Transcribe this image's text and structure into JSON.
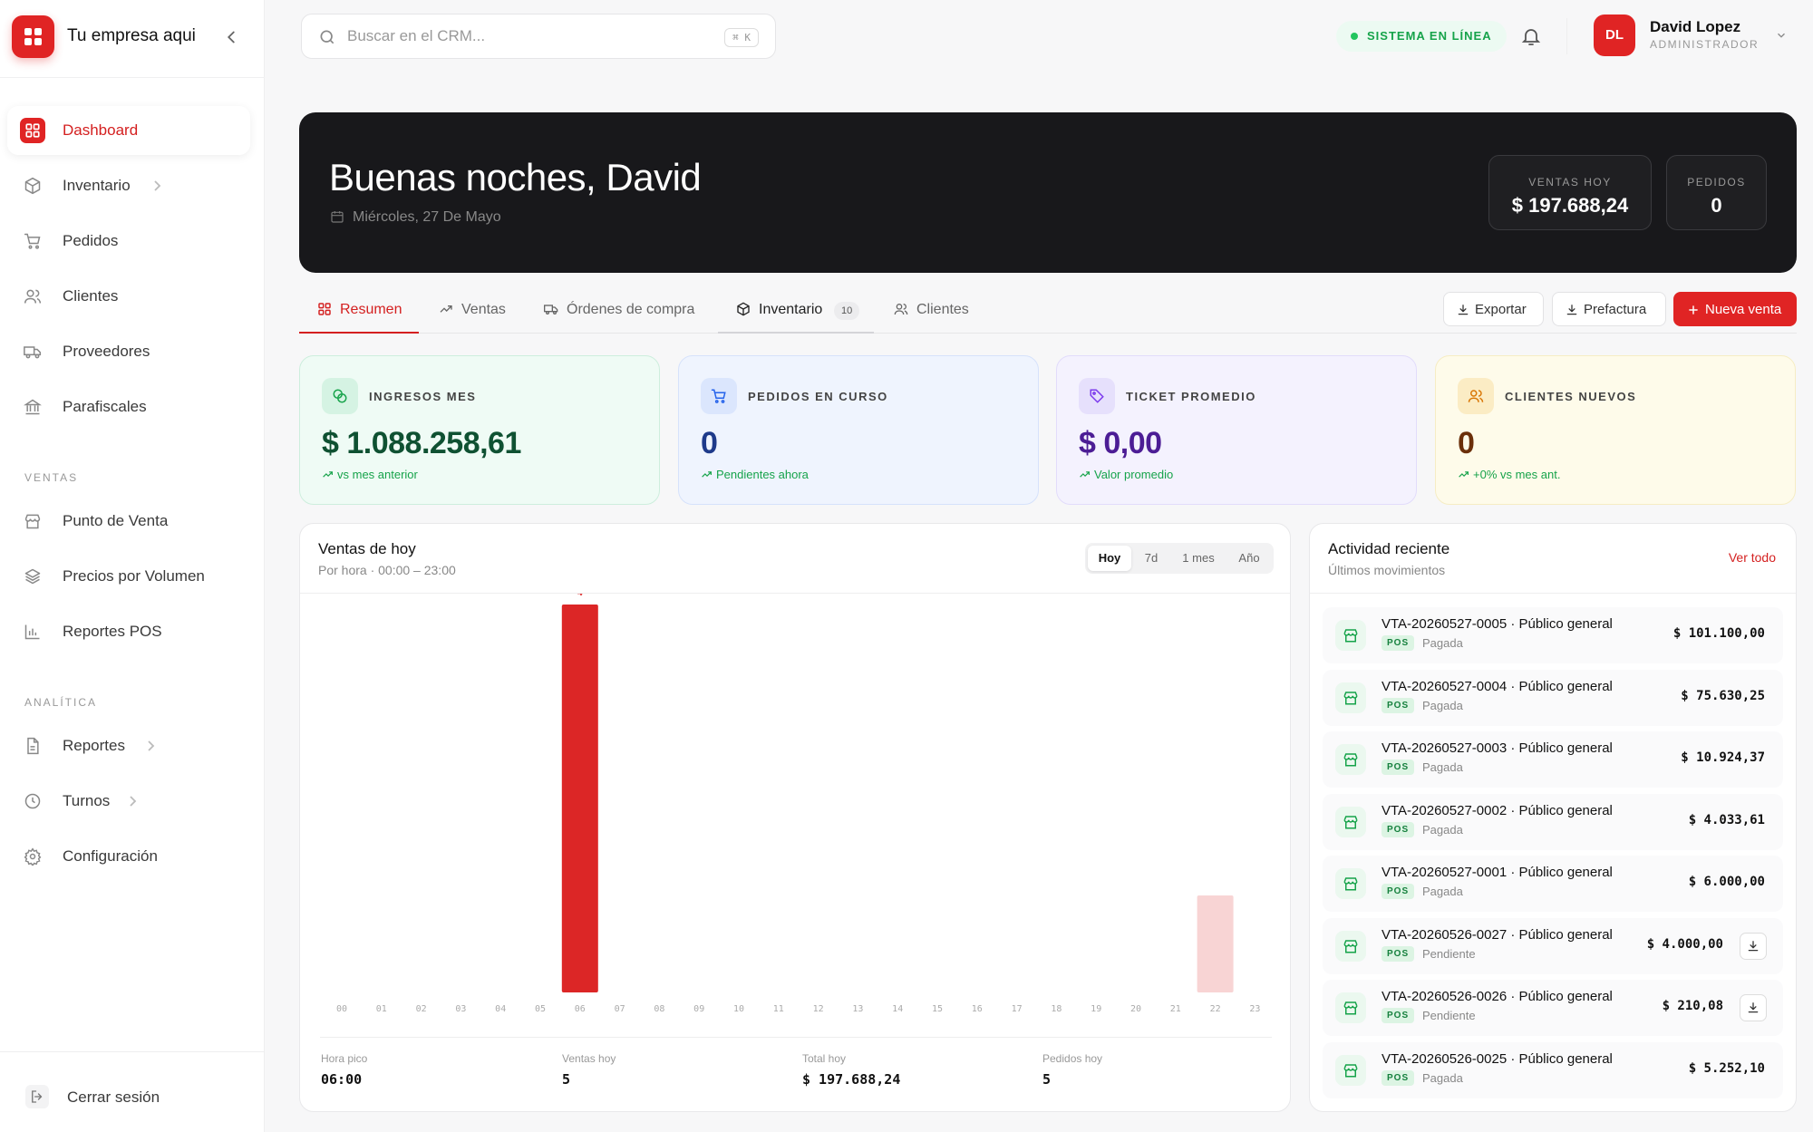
{
  "brand": {
    "name": "Tu empresa aqui",
    "logo": "grid-icon"
  },
  "sidebar": {
    "items": [
      {
        "label": "Dashboard",
        "icon": "dashboard-icon",
        "active": true
      },
      {
        "label": "Inventario",
        "icon": "box-icon",
        "chevron": true
      },
      {
        "label": "Pedidos",
        "icon": "cart-icon"
      },
      {
        "label": "Clientes",
        "icon": "users-icon"
      },
      {
        "label": "Proveedores",
        "icon": "truck-icon"
      },
      {
        "label": "Parafiscales",
        "icon": "bank-icon"
      }
    ],
    "section_ventas": "VENTAS",
    "ventas_items": [
      {
        "label": "Punto de Venta",
        "icon": "store-icon"
      },
      {
        "label": "Precios por Volumen",
        "icon": "layers-icon"
      },
      {
        "label": "Reportes POS",
        "icon": "bar-chart-icon"
      }
    ],
    "section_analitica": "ANALÍTICA",
    "analitica_items": [
      {
        "label": "Reportes",
        "icon": "file-icon",
        "chevron": true
      },
      {
        "label": "Turnos",
        "icon": "clock-icon",
        "chevron": true
      },
      {
        "label": "Configuración",
        "icon": "gear-icon"
      }
    ],
    "logout_label": "Cerrar sesión"
  },
  "topbar": {
    "search_placeholder": "Buscar en el CRM...",
    "search_shortcut": "⌘ K",
    "status": "SISTEMA EN LÍNEA",
    "user": {
      "initials": "DL",
      "name": "David Lopez",
      "role": "ADMINISTRADOR"
    }
  },
  "hero": {
    "greeting": "Buenas noches, David",
    "date": "Miércoles, 27 De Mayo",
    "stats": [
      {
        "label": "VENTAS HOY",
        "value": "$ 197.688,24"
      },
      {
        "label": "PEDIDOS",
        "value": "0"
      }
    ]
  },
  "tabs": [
    {
      "label": "Resumen",
      "icon": "dashboard-icon",
      "active": true
    },
    {
      "label": "Ventas",
      "icon": "trend-icon"
    },
    {
      "label": "Órdenes de compra",
      "icon": "truck-icon"
    },
    {
      "label": "Inventario",
      "icon": "box-icon",
      "badge": "10"
    },
    {
      "label": "Clientes",
      "icon": "users-icon"
    }
  ],
  "actions": {
    "export": "Exportar",
    "prefactura": "Prefactura",
    "new_sale": "Nueva venta"
  },
  "kpis": [
    {
      "label": "INGRESOS MES",
      "value": "$ 1.088.258,61",
      "sub": "vs mes anterior",
      "icon": "coins-icon",
      "bg": "#effbf5",
      "border": "#cdeedd",
      "iconbg": "#d5f3e3",
      "color": "#0f5132",
      "subcolor": "#16a34a"
    },
    {
      "label": "PEDIDOS EN CURSO",
      "value": "0",
      "sub": "Pendientes ahora",
      "icon": "cart-icon",
      "bg": "#eff4fe",
      "border": "#d6e2fb",
      "iconbg": "#dbe6fd",
      "color": "#1e3a8a",
      "subcolor": "#16a34a"
    },
    {
      "label": "TICKET PROMEDIO",
      "value": "$ 0,00",
      "sub": "Valor promedio",
      "icon": "tag-icon",
      "bg": "#f4f2fe",
      "border": "#e2dcfb",
      "iconbg": "#e6e0fc",
      "color": "#4c1d95",
      "subcolor": "#16a34a"
    },
    {
      "label": "CLIENTES NUEVOS",
      "value": "0",
      "sub": "+0% vs mes ant.",
      "icon": "users-icon",
      "bg": "#fefbea",
      "border": "#f6edc4",
      "iconbg": "#fbecc4",
      "color": "#6b2f0a",
      "subcolor": "#16a34a"
    }
  ],
  "chart_panel": {
    "title": "Ventas de hoy",
    "subtitle": "Por hora · 00:00 – 23:00",
    "ranges": [
      "Hoy",
      "7d",
      "1 mes",
      "Año"
    ],
    "selected_range": "Hoy",
    "footer": [
      {
        "label": "Hora pico",
        "value": "06:00"
      },
      {
        "label": "Ventas hoy",
        "value": "5"
      },
      {
        "label": "Total hoy",
        "value": "$ 197.688,24"
      },
      {
        "label": "Pedidos hoy",
        "value": "5"
      }
    ]
  },
  "chart_data": {
    "type": "bar",
    "categories": [
      "00",
      "01",
      "02",
      "03",
      "04",
      "05",
      "06",
      "07",
      "08",
      "09",
      "10",
      "11",
      "12",
      "13",
      "14",
      "15",
      "16",
      "17",
      "18",
      "19",
      "20",
      "21",
      "22",
      "23"
    ],
    "values": [
      0,
      0,
      0,
      0,
      0,
      0,
      4,
      0,
      0,
      0,
      0,
      0,
      0,
      0,
      0,
      0,
      0,
      0,
      0,
      0,
      0,
      0,
      1,
      0
    ],
    "highlight_index": 6,
    "data_labels": {
      "6": "4"
    },
    "ylim": [
      0,
      4
    ],
    "grid": false,
    "colors": {
      "peak": "#dc2626",
      "other": "#f8d4d4"
    }
  },
  "activity": {
    "title": "Actividad reciente",
    "subtitle": "Últimos movimientos",
    "link": "Ver todo",
    "rows": [
      {
        "title": "VTA-20260527-0005 · Público general",
        "tag": "POS",
        "status": "Pagada",
        "amount": "$ 101.100,00",
        "download": false
      },
      {
        "title": "VTA-20260527-0004 · Público general",
        "tag": "POS",
        "status": "Pagada",
        "amount": "$ 75.630,25",
        "download": false
      },
      {
        "title": "VTA-20260527-0003 · Público general",
        "tag": "POS",
        "status": "Pagada",
        "amount": "$ 10.924,37",
        "download": false
      },
      {
        "title": "VTA-20260527-0002 · Público general",
        "tag": "POS",
        "status": "Pagada",
        "amount": "$ 4.033,61",
        "download": false
      },
      {
        "title": "VTA-20260527-0001 · Público general",
        "tag": "POS",
        "status": "Pagada",
        "amount": "$ 6.000,00",
        "download": false
      },
      {
        "title": "VTA-20260526-0027 · Público general",
        "tag": "POS",
        "status": "Pendiente",
        "amount": "$ 4.000,00",
        "download": true
      },
      {
        "title": "VTA-20260526-0026 · Público general",
        "tag": "POS",
        "status": "Pendiente",
        "amount": "$ 210,08",
        "download": true
      },
      {
        "title": "VTA-20260526-0025 · Público general",
        "tag": "POS",
        "status": "Pagada",
        "amount": "$ 5.252,10",
        "download": false
      }
    ]
  }
}
